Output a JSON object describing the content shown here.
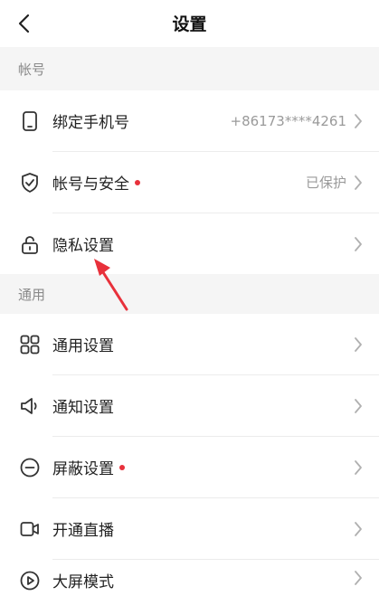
{
  "header": {
    "title": "设置"
  },
  "sections": {
    "account": {
      "label": "帐号"
    },
    "general": {
      "label": "通用"
    }
  },
  "rows": {
    "bind_phone": {
      "label": "绑定手机号",
      "value": "+86173****4261",
      "icon": "phone-icon"
    },
    "account_security": {
      "label": "帐号与安全",
      "value": "已保护",
      "icon": "shield-check-icon",
      "badge": true
    },
    "privacy": {
      "label": "隐私设置",
      "icon": "lock-icon"
    },
    "general_settings": {
      "label": "通用设置",
      "icon": "grid-icon"
    },
    "notification": {
      "label": "通知设置",
      "icon": "speaker-icon"
    },
    "block": {
      "label": "屏蔽设置",
      "icon": "minus-circle-icon",
      "badge": true
    },
    "live": {
      "label": "开通直播",
      "icon": "video-camera-icon"
    },
    "big_screen": {
      "label": "大屏模式",
      "icon": "play-circle-icon"
    }
  },
  "colors": {
    "badge": "#e8313b",
    "annotation_arrow": "#e8313b",
    "section_bg": "#f5f5f5"
  }
}
